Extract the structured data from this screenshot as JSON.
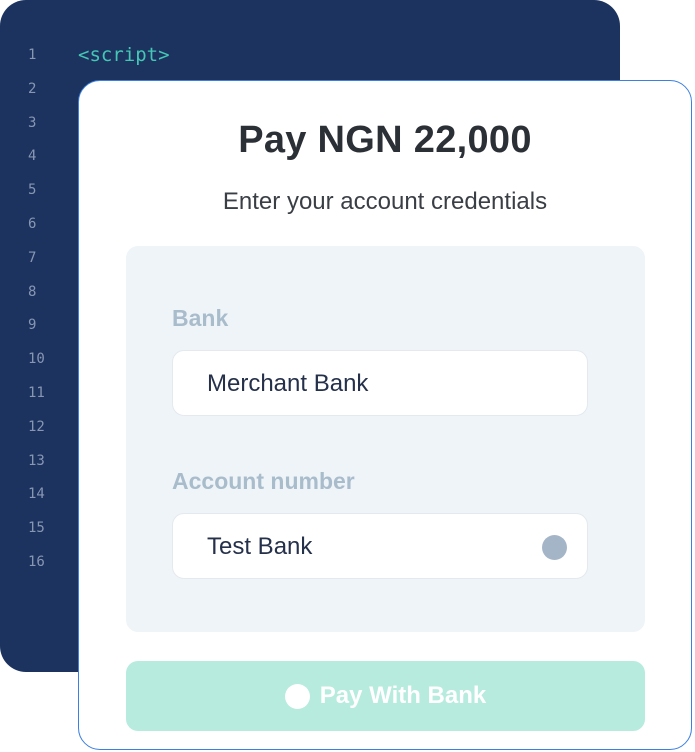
{
  "code_editor": {
    "line_numbers": [
      "1",
      "2",
      "3",
      "4",
      "5",
      "6",
      "7",
      "8",
      "9",
      "10",
      "11",
      "12",
      "13",
      "14",
      "15",
      "16"
    ],
    "first_line": "<script>"
  },
  "payment": {
    "title": "Pay NGN 22,000",
    "subtitle": "Enter your account credentials",
    "bank_label": "Bank",
    "bank_value": "Merchant Bank",
    "account_label": "Account number",
    "account_value": "Test Bank",
    "pay_button_label": "Pay With Bank"
  },
  "colors": {
    "code_background": "#1b335e",
    "code_keyword": "#45c7b5",
    "card_border": "#3b7fe0",
    "button_background": "#b7ebdd",
    "label_color": "#a9bccb"
  },
  "icons": {
    "account_status": "status-dot-icon",
    "button_loading": "spinner-icon"
  }
}
